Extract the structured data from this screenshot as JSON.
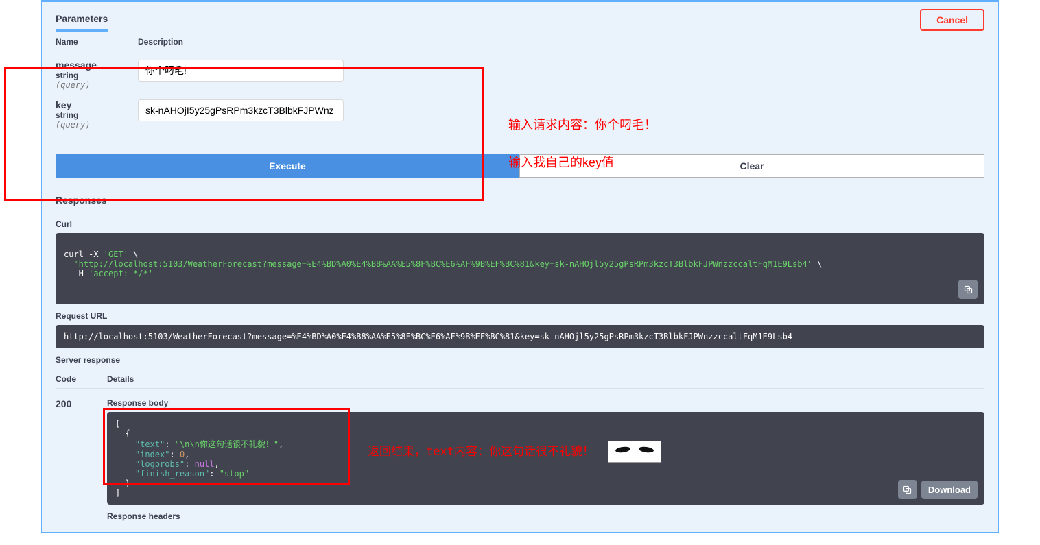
{
  "tabs": {
    "parameters_label": "Parameters"
  },
  "buttons": {
    "cancel": "Cancel",
    "execute": "Execute",
    "clear": "Clear",
    "download": "Download"
  },
  "param_header": {
    "name": "Name",
    "description": "Description"
  },
  "params": {
    "message": {
      "name": "message",
      "type": "string",
      "in": "(query)",
      "value": "你个叼毛!"
    },
    "key": {
      "name": "key",
      "type": "string",
      "in": "(query)",
      "value": "sk-nAHOjI5y25gPsRPm3kzcT3BlbkFJPWnz"
    }
  },
  "annotations": {
    "a1": "输入请求内容：你个叼毛！",
    "a2": "输入我自己的key值",
    "a3": "返回结果，text内容：你这句话很不礼貌！"
  },
  "responses": {
    "header": "Responses",
    "curl_label": "Curl",
    "curl_line1a": "curl -X ",
    "curl_line1b": "'GET'",
    "curl_line1c": " \\",
    "curl_line2": "  'http://localhost:5103/WeatherForecast?message=%E4%BD%A0%E4%B8%AA%E5%8F%BC%E6%AF%9B%EF%BC%81&key=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'",
    "curl_line2b": " \\",
    "curl_line3a": "  -H ",
    "curl_line3b": "'accept: */*'",
    "request_url_label": "Request URL",
    "request_url": "http://localhost:5103/WeatherForecast?message=%E4%BD%A0%E4%B8%AA%E5%8F%BC%E6%AF%9B%EF%BC%81&key=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",
    "server_response_label": "Server response",
    "code_col": "Code",
    "details_col": "Details",
    "status_code": "200",
    "response_body_label": "Response body",
    "body": {
      "l1": "[",
      "l2": "  {",
      "l3a": "    \"text\"",
      "l3b": ": ",
      "l3c": "\"\\n\\n你这句话很不礼貌！\"",
      "l3d": ",",
      "l4a": "    \"index\"",
      "l4b": ": ",
      "l4c": "0",
      "l4d": ",",
      "l5a": "    \"logprobs\"",
      "l5b": ": ",
      "l5c": "null",
      "l5d": ",",
      "l6a": "    \"finish_reason\"",
      "l6b": ": ",
      "l6c": "\"stop\"",
      "l7": "  }",
      "l8": "]"
    },
    "response_headers_label": "Response headers"
  }
}
